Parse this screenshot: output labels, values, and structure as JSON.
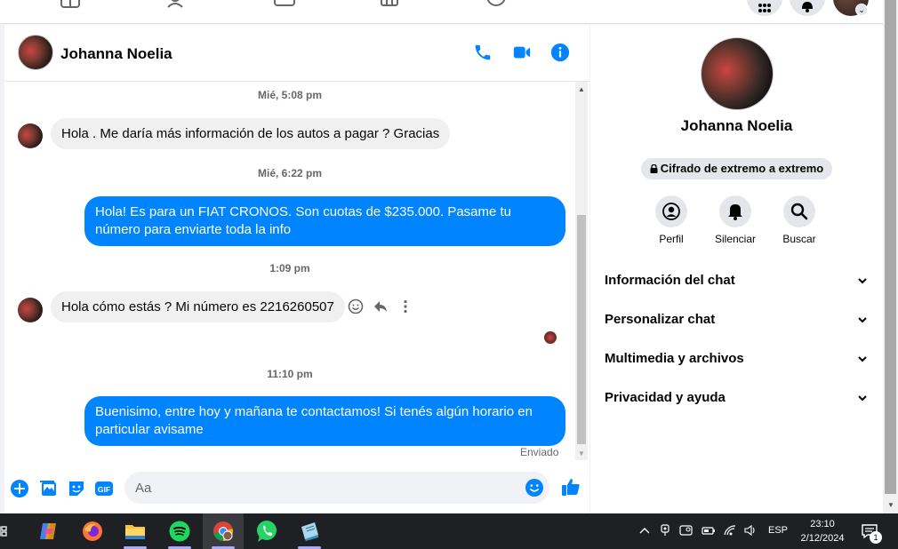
{
  "contact": {
    "name": "Johanna Noelia"
  },
  "messages": [
    {
      "timestamp": "Mié, 5:08 pm",
      "direction": "in",
      "text": "Hola . Me daría más información de los autos a pagar ? Gracias"
    },
    {
      "timestamp": "Mié, 6:22 pm",
      "direction": "out",
      "text": "Hola! Es para un FIAT CRONOS. Son cuotas de $235.000. Pasame tu número para enviarte toda la info"
    },
    {
      "timestamp": "1:09 pm",
      "direction": "in",
      "text": "Hola cómo estás ? Mi número es 2216260507"
    },
    {
      "timestamp": "11:10 pm",
      "direction": "out",
      "text": "Buenisimo, entre hoy y mañana te contactamos! Si tenés algún horario en particular avisame"
    }
  ],
  "sent_status": "Enviado",
  "composer": {
    "placeholder": "Aa"
  },
  "composer_icons": {
    "gif_label": "GIF"
  },
  "panel": {
    "encryption_label": "Cifrado de extremo a extremo",
    "actions": [
      {
        "label": "Perfil",
        "icon": "profile-icon"
      },
      {
        "label": "Silenciar",
        "icon": "bell-icon"
      },
      {
        "label": "Buscar",
        "icon": "search-icon"
      }
    ],
    "sections": [
      {
        "label": "Información del chat"
      },
      {
        "label": "Personalizar chat"
      },
      {
        "label": "Multimedia y archivos"
      },
      {
        "label": "Privacidad y ayuda"
      }
    ]
  },
  "taskbar": {
    "language": "ESP",
    "time": "23:10",
    "date": "2/12/2024",
    "notification_count": "1",
    "apps": [
      "copilot",
      "firefox",
      "file-explorer",
      "spotify",
      "chrome",
      "whatsapp",
      "notepad"
    ]
  },
  "colors": {
    "accent": "#0084ff",
    "incoming_bubble": "#f0f0f0",
    "panel_bg": "#ffffff",
    "taskbar_bg": "#1f2023"
  }
}
